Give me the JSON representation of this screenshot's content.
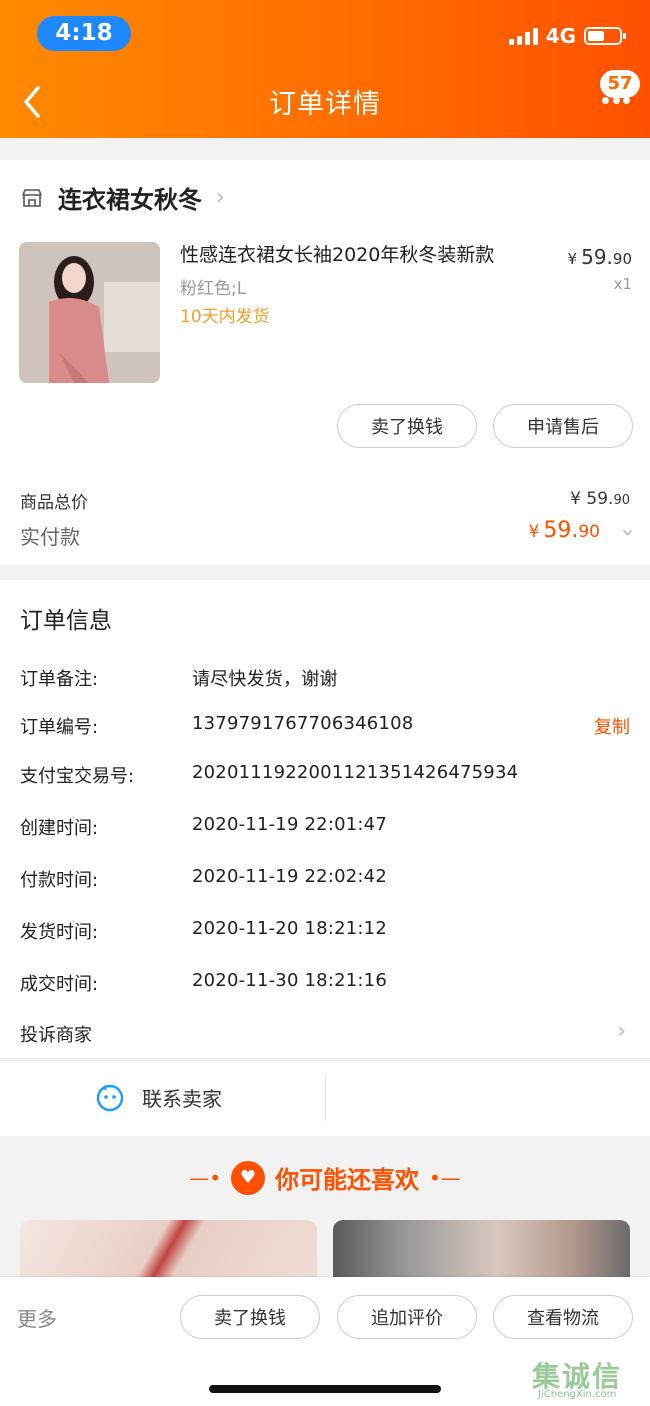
{
  "status_bar": {
    "time": "4:18",
    "network": "4G"
  },
  "header": {
    "title": "订单详情",
    "badge": "57"
  },
  "shop": {
    "name": "连衣裙女秋冬"
  },
  "product": {
    "title": "性感连衣裙女长袖2020年秋冬装新款",
    "sku": "粉红色;L",
    "shipping": "10天内发货",
    "price_symbol": "¥",
    "price_int": "59.",
    "price_dec": "90",
    "quantity": "x1"
  },
  "actions": {
    "sell": "卖了换钱",
    "after_sale": "申请售后"
  },
  "summary": {
    "total_label": "商品总价",
    "total_symbol": "¥",
    "total_int": "59.",
    "total_dec": "90",
    "paid_label": "实付款",
    "paid_symbol": "¥",
    "paid_int": "59.",
    "paid_dec": "90"
  },
  "order_info": {
    "title": "订单信息",
    "rows": [
      {
        "key": "订单备注:",
        "value": "请尽快发货，谢谢"
      },
      {
        "key": "订单编号:",
        "value": "1379791767706346108"
      },
      {
        "key": "支付宝交易号:",
        "value": "2020111922001121351426475934"
      },
      {
        "key": "创建时间:",
        "value": "2020-11-19 22:01:47"
      },
      {
        "key": "付款时间:",
        "value": "2020-11-19 22:02:42"
      },
      {
        "key": "发货时间:",
        "value": "2020-11-20 18:21:12"
      },
      {
        "key": "成交时间:",
        "value": "2020-11-30 18:21:16"
      }
    ],
    "copy_label": "复制",
    "complaint": "投诉商家"
  },
  "contact": {
    "label": "联系卖家"
  },
  "recommend": {
    "title": "你可能还喜欢"
  },
  "bottom": {
    "more": "更多",
    "b1": "卖了换钱",
    "b2": "追加评价",
    "b3": "查看物流"
  },
  "watermark": {
    "main": "集诚信",
    "sub": "JiChengXin.com"
  },
  "colors": {
    "accent": "#ff5000",
    "header_from": "#ff8a00",
    "header_to": "#ff5000",
    "ship": "#f29d2c"
  }
}
